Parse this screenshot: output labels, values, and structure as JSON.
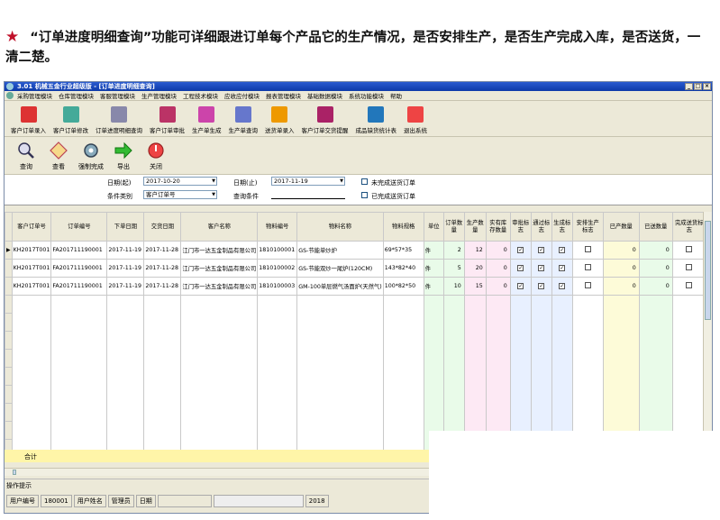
{
  "intro": {
    "star": "★",
    "text": "“订单进度明细查询”功能可详细跟进订单每个产品它的生产情况，是否安排生产，是否生产完成入库，是否送货，一清二楚。"
  },
  "window": {
    "title": "3.01 机械五金行业超级版 - [订单进度明细查询]",
    "controls": [
      "_",
      "□",
      "×"
    ],
    "menu": [
      "采购管理模块",
      "仓库管理模块",
      "客服管理模块",
      "生产管理模块",
      "工程技术模块",
      "应收应付模块",
      "报表管理模块",
      "基础数据模块",
      "系统功能模块",
      "帮助"
    ]
  },
  "toolbar_main": [
    {
      "label": "客户订单录入",
      "color": "#d33"
    },
    {
      "label": "客户订单修改",
      "color": "#4a9"
    },
    {
      "label": "订单进度明细查询",
      "color": "#88a"
    },
    {
      "label": "客户订单审批",
      "color": "#b36"
    },
    {
      "label": "生产单生成",
      "color": "#c4a"
    },
    {
      "label": "生产单查询",
      "color": "#67c"
    },
    {
      "label": "送货单录入",
      "color": "#e90"
    },
    {
      "label": "客户订单交货提醒",
      "color": "#a26"
    },
    {
      "label": "成品缺货统计表",
      "color": "#27b"
    },
    {
      "label": "退出系统",
      "color": "#e44"
    }
  ],
  "toolbar_actions": [
    {
      "label": "查询",
      "icon": "magnifier-icon"
    },
    {
      "label": "查看",
      "icon": "diamond-icon"
    },
    {
      "label": "强制完成",
      "icon": "gear-icon"
    },
    {
      "label": "导出",
      "icon": "arrow-right-icon"
    },
    {
      "label": "关闭",
      "icon": "power-icon"
    }
  ],
  "filter": {
    "date_from_label": "日期(起)",
    "date_from": "2017-10-20",
    "date_to_label": "日期(止)",
    "date_to": "2017-11-19",
    "cond_type_label": "条件类别",
    "cond_type": "客户订单号",
    "cond_label": "查询条件",
    "cond_value": "",
    "chk1": "未完成送货订单",
    "chk2": "已完成送货订单"
  },
  "columns": [
    "客户订单号",
    "订单编号",
    "下单日期",
    "交货日期",
    "客户名称",
    "物料编号",
    "物料名称",
    "物料规格",
    "单位",
    "订单数量",
    "生产数量",
    "实有库存数量",
    "审批标志",
    "通过标志",
    "生成标志",
    "安排生产标志",
    "已产数量",
    "已送数量",
    "完成送货标志"
  ],
  "rows": [
    [
      "KH2017T001",
      "FA201711190001",
      "2017-11-19",
      "2017-11-28",
      "江门市一达五金制品有限公司",
      "1810100001",
      "GS-节能单炒炉",
      "69*57*35",
      "件",
      "2",
      "12",
      "0",
      "✓",
      "✓",
      "✓",
      "",
      "0",
      "0",
      ""
    ],
    [
      "KH2017T001",
      "FA201711190001",
      "2017-11-19",
      "2017-11-28",
      "江门市一达五金制品有限公司",
      "1810100002",
      "GS-节能双炒一尾炉(120CM)",
      "143*82*40",
      "件",
      "5",
      "20",
      "0",
      "✓",
      "✓",
      "✓",
      "",
      "0",
      "0",
      ""
    ],
    [
      "KH2017T001",
      "FA201711190001",
      "2017-11-19",
      "2017-11-28",
      "江门市一达五金制品有限公司",
      "1810100003",
      "GM-100单层燃气汤面炉(天然气)",
      "100*82*50",
      "件",
      "10",
      "15",
      "0",
      "✓",
      "✓",
      "✓",
      "",
      "0",
      "0",
      ""
    ]
  ],
  "total_label": "合计",
  "hint_label": "操作提示",
  "status": {
    "user_id_label": "用户编号",
    "user_id": "180001",
    "user_name_label": "用户姓名",
    "user_name": "管理员",
    "date_label": "日期",
    "year_suffix": "2018"
  },
  "colors": {
    "accent": "#0d3aa8",
    "star": "#c0102a",
    "total_row": "#fff5a8"
  }
}
